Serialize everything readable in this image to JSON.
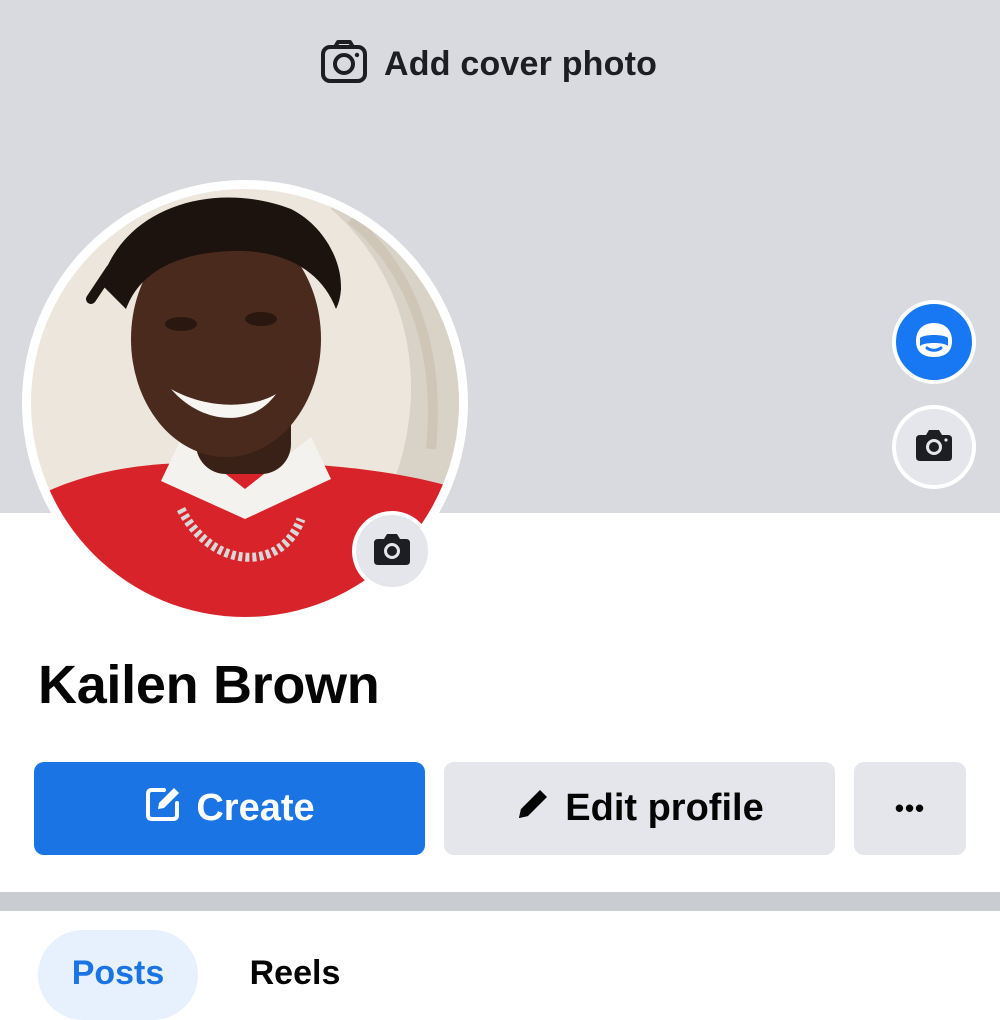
{
  "cover": {
    "add_cover_label": "Add cover photo",
    "icon": "camera-icon",
    "background": "#d9dadf"
  },
  "profile": {
    "name": "Kailen Brown",
    "avatar_camera_icon": "camera-icon"
  },
  "side_buttons": [
    {
      "icon": "avatar-icon",
      "color": "#1877f2"
    },
    {
      "icon": "camera-icon",
      "color": "#e4e6eb"
    }
  ],
  "actions": {
    "create_label": "Create",
    "create_icon": "edit-square-icon",
    "edit_label": "Edit profile",
    "edit_icon": "pencil-icon",
    "more_label": "•••",
    "accent": "#1b74e4"
  },
  "tabs": [
    {
      "label": "Posts",
      "active": true
    },
    {
      "label": "Reels",
      "active": false
    }
  ]
}
